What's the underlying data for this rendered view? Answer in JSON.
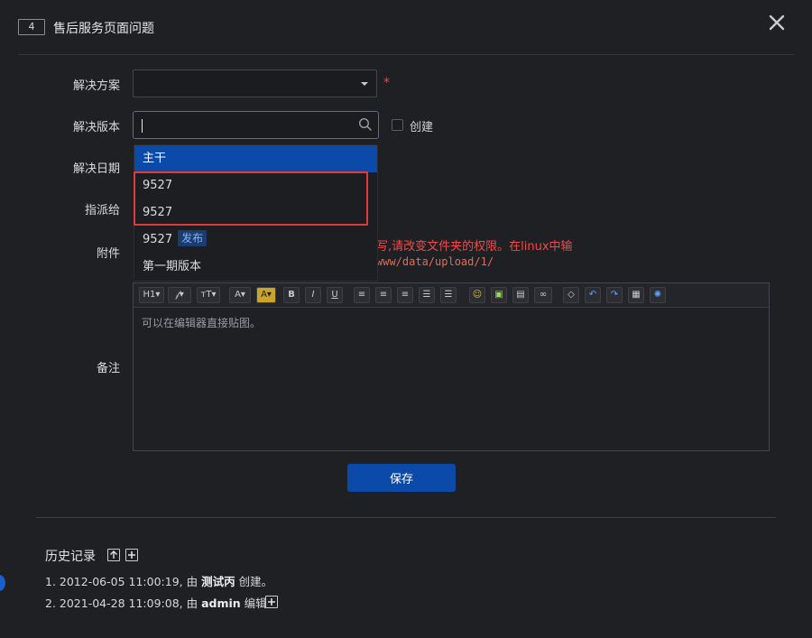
{
  "dialog": {
    "id_badge": "4",
    "title": "售后服务页面问题"
  },
  "form": {
    "solution_label": "解决方案",
    "solution_value": "",
    "required_mark": "*",
    "version_label": "解决版本",
    "version_search_value": "",
    "create_label": "创建",
    "date_label": "解决日期",
    "assign_label": "指派给",
    "attach_label": "附件",
    "attach_warning": "写,请改变文件夹的权限。在linux中输",
    "attach_path": "www/data/upload/1/",
    "note_label": "备注",
    "editor_placeholder": "可以在编辑器直接贴图。"
  },
  "version_dropdown": {
    "options": [
      {
        "label": "主干",
        "selected": true
      },
      {
        "label": "9527"
      },
      {
        "label": "9527"
      },
      {
        "label": "9527",
        "badge": "发布"
      },
      {
        "label": "第一期版本"
      }
    ]
  },
  "toolbar": {
    "heading": "H1",
    "items": [
      "heading",
      "font-family",
      "font-size",
      "font-color",
      "highlight",
      "bold",
      "italic",
      "underline",
      "align-left",
      "align-center",
      "align-right",
      "ordered-list",
      "unordered-list",
      "emoticon",
      "image",
      "page-break",
      "link",
      "eraser",
      "undo",
      "redo",
      "paste-text",
      "source"
    ]
  },
  "actions": {
    "save_label": "保存"
  },
  "history": {
    "title": "历史记录",
    "entries": [
      {
        "prefix": "1. 2012-06-05 11:00:19, 由 ",
        "user": "测试丙",
        "suffix": " 创建。"
      },
      {
        "prefix": "2. 2021-04-28 11:09:08, 由 ",
        "user": "admin",
        "suffix": " 编辑。"
      }
    ]
  },
  "colors": {
    "background": "#1f2024",
    "accent": "#0b4aa8",
    "warning": "#ee4b4b",
    "highlight_border": "#e03a3a"
  }
}
